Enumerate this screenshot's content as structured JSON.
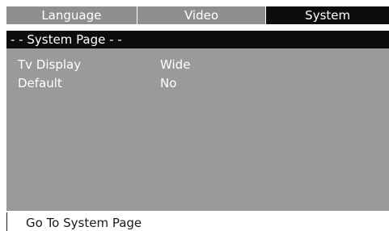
{
  "tabs": [
    {
      "label": "Language",
      "active": false
    },
    {
      "label": "Video",
      "active": false
    },
    {
      "label": "System",
      "active": true
    }
  ],
  "panel": {
    "header": "- - System Page - -",
    "rows": [
      {
        "label": "Tv Display",
        "value": "Wide"
      },
      {
        "label": "Default",
        "value": "No"
      }
    ]
  },
  "status": {
    "text": "Go To System Page"
  },
  "colors": {
    "tab_inactive": "#8f8f8f",
    "tab_active": "#0d0d0d",
    "panel_background": "#9a9a9a",
    "header_background": "#0d0d0d"
  }
}
